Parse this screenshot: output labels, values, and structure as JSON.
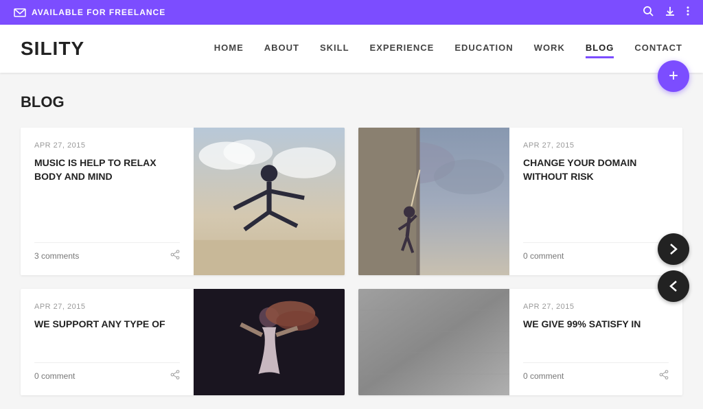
{
  "topbar": {
    "message": "AVAILABLE FOR FREELANCE",
    "icons": [
      "search",
      "download",
      "more"
    ]
  },
  "header": {
    "logo": "SILITY",
    "nav": [
      {
        "label": "HOME",
        "active": false
      },
      {
        "label": "ABOUT",
        "active": false
      },
      {
        "label": "SKILL",
        "active": false
      },
      {
        "label": "EXPERIENCE",
        "active": false
      },
      {
        "label": "EDUCATION",
        "active": false
      },
      {
        "label": "WORK",
        "active": false
      },
      {
        "label": "BLOG",
        "active": true
      },
      {
        "label": "CONTACT",
        "active": false
      }
    ]
  },
  "fab": {
    "label": "+"
  },
  "page": {
    "section_title": "BLOG"
  },
  "blog_cards": [
    {
      "id": 1,
      "date": "APR 27, 2015",
      "title": "MUSIC IS HELP TO RELAX BODY AND MIND",
      "comments": "3 comments",
      "image_type": "dance"
    },
    {
      "id": 2,
      "date": "APR 27, 2015",
      "title": "CHANGE YOUR DOMAIN WITHOUT RISK",
      "comments": "0 comment",
      "image_type": "climb"
    },
    {
      "id": 3,
      "date": "APR 27, 2015",
      "title": "WE SUPPORT ANY TYPE OF",
      "comments": "0 comment",
      "image_type": "dance2"
    },
    {
      "id": 4,
      "date": "APR 27, 2015",
      "title": "WE GIVE 99% SATISFY IN",
      "comments": "0 comment",
      "image_type": "texture"
    }
  ],
  "nav_arrows": {
    "next": "❯",
    "prev": "❮"
  }
}
